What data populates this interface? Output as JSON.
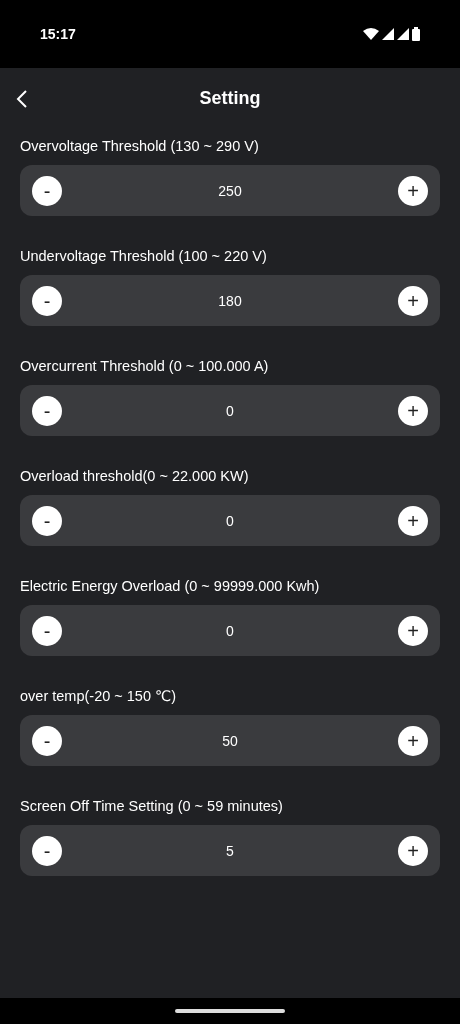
{
  "status_bar": {
    "time": "15:17"
  },
  "header": {
    "title": "Setting"
  },
  "settings": [
    {
      "label": "Overvoltage Threshold (130 ~ 290 V)",
      "value": "250",
      "minus": "-",
      "plus": "+"
    },
    {
      "label": "Undervoltage Threshold (100 ~ 220 V)",
      "value": "180",
      "minus": "-",
      "plus": "+"
    },
    {
      "label": "Overcurrent Threshold (0 ~ 100.000 A)",
      "value": "0",
      "minus": "-",
      "plus": "+"
    },
    {
      "label": "Overload threshold(0 ~ 22.000 KW)",
      "value": "0",
      "minus": "-",
      "plus": "+"
    },
    {
      "label": "Electric Energy Overload (0 ~ 99999.000 Kwh)",
      "value": "0",
      "minus": "-",
      "plus": "+"
    },
    {
      "label": "over temp(-20 ~ 150 ℃)",
      "value": "50",
      "minus": "-",
      "plus": "+"
    },
    {
      "label": "Screen Off Time Setting (0 ~ 59 minutes)",
      "value": "5",
      "minus": "-",
      "plus": "+"
    }
  ]
}
